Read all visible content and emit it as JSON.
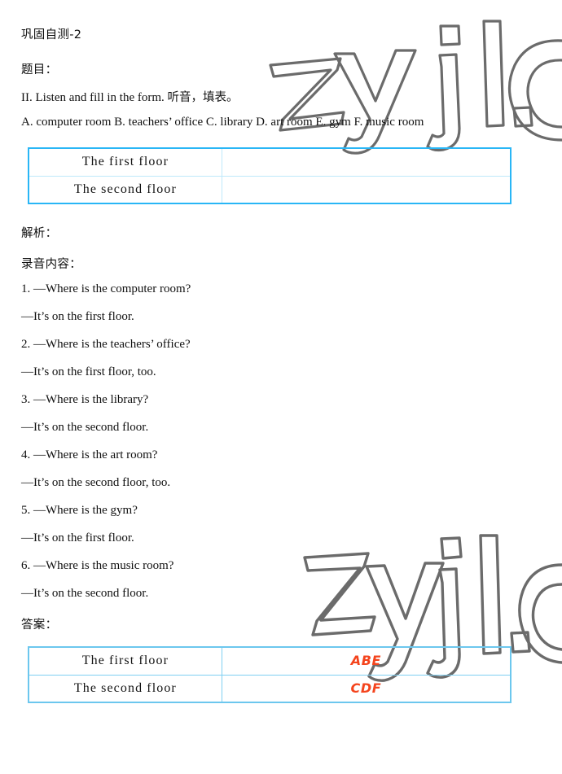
{
  "document": {
    "heading": "巩固自测-2",
    "question_label": "题目：",
    "instruction_en": "II. Listen and fill in the form. ",
    "instruction_zh": "听音，填表。",
    "options_line": "A. computer room B. teachers’ office C. library D. art room E. gym F. music room",
    "analysis_label": "解析：",
    "transcript_label": "录音内容：",
    "answer_label": "答案："
  },
  "transcript": [
    "1. —Where is the computer room?",
    "—It’s on the first floor.",
    "2. —Where is the teachers’ office?",
    "—It’s on the first floor, too.",
    "3. —Where is the library?",
    "—It’s on the second floor.",
    "4. —Where is the art room?",
    "—It’s on the second floor, too.",
    "5. —Where is the gym?",
    "—It’s on the first floor.",
    "6. —Where is the music room?",
    "—It’s on the second floor."
  ],
  "blank_table": {
    "rows": [
      {
        "label": "The  first  floor",
        "value": ""
      },
      {
        "label": "The  second  floor",
        "value": ""
      }
    ]
  },
  "answer_table": {
    "rows": [
      {
        "label": "The  first  floor",
        "value": "ABE"
      },
      {
        "label": "The  second  floor",
        "value": "CDF"
      }
    ]
  },
  "watermark": {
    "text": "zyjl.c",
    "color": "#6b6b6b"
  },
  "colors": {
    "table_border_top": "#29b6f6",
    "table_border_bottom": "#6cc7ee",
    "table_inner_line": "#bfe9fb",
    "answer_text": "#f4441d",
    "body_text": "#111111"
  }
}
